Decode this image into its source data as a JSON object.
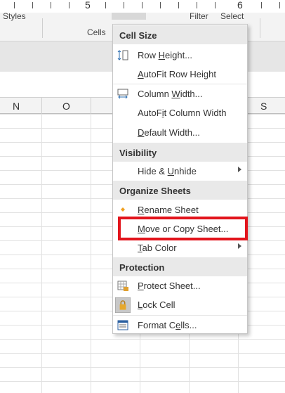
{
  "ruler": {
    "marks": [
      "5",
      "6"
    ]
  },
  "ribbon": {
    "styles_label": "Styles",
    "cells_label": "Cells",
    "filter_label": "Filter",
    "select_label": "Select"
  },
  "columns": [
    "N",
    "O",
    "S"
  ],
  "menu": {
    "sections": {
      "cell_size": "Cell Size",
      "visibility": "Visibility",
      "organize": "Organize Sheets",
      "protection": "Protection"
    },
    "items": {
      "row_height": {
        "pre": "Row ",
        "ul": "H",
        "post": "eight..."
      },
      "autofit_row": {
        "pre": "",
        "ul": "A",
        "post": "utoFit Row Height"
      },
      "col_width": {
        "pre": "Column ",
        "ul": "W",
        "post": "idth..."
      },
      "autofit_col": {
        "pre": "AutoF",
        "ul": "i",
        "post": "t Column Width"
      },
      "default_width": {
        "pre": "",
        "ul": "D",
        "post": "efault Width..."
      },
      "hide_unhide": {
        "pre": "Hide & ",
        "ul": "U",
        "post": "nhide"
      },
      "rename_sheet": {
        "pre": "",
        "ul": "R",
        "post": "ename Sheet"
      },
      "move_copy": {
        "pre": "",
        "ul": "M",
        "post": "ove or Copy Sheet..."
      },
      "tab_color": {
        "pre": "",
        "ul": "T",
        "post": "ab Color"
      },
      "protect_sheet": {
        "pre": "",
        "ul": "P",
        "post": "rotect Sheet..."
      },
      "lock_cell": {
        "pre": "",
        "ul": "L",
        "post": "ock Cell"
      },
      "format_cells": {
        "pre": "Format C",
        "ul": "e",
        "post": "lls..."
      }
    }
  },
  "colors": {
    "highlight": "#e2141c",
    "rename_dot": "#f0a020"
  }
}
